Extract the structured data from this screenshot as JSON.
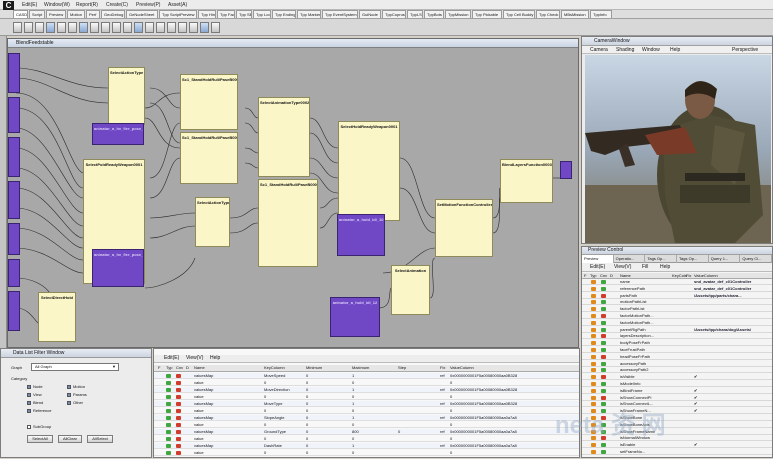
{
  "app": {
    "logo": "C"
  },
  "menubar": [
    "Edit(E)",
    "Window(W)",
    "Report(R)",
    "Create(C)",
    "Preview(P)",
    "Asset(A)"
  ],
  "tabs": [
    "CASDebug",
    "Script",
    "Preview",
    "Motion",
    "Perf",
    "GeoDebug",
    "GeNodeSheet",
    "Tpp ScriptPreview",
    "Tpp Hint",
    "Tpp Fade",
    "Tpp SE",
    "Tpp Loop",
    "Tpp Ending",
    "Tpp Marker",
    "Tpp EventSystem",
    "GuiNode",
    "TppCoprus",
    "TppLS",
    "TppBots",
    "TppMission",
    "Tpp Pickable",
    "Tpp Cell Buddy",
    "Tpp Check",
    "MBsMission",
    "TppInfo"
  ],
  "graph": {
    "title": "BlendFeedstable",
    "nodes": [
      {
        "label": "SelectActionType"
      },
      {
        "label": "Sc1_StandHoldRuli/PaseB0003"
      },
      {
        "label": "SelectAnimationType0002"
      },
      {
        "label": "Sc1_StandHoldRuli/PaseB0004"
      },
      {
        "label": "SelectHoldReadyWeapon0001"
      },
      {
        "label": "SelectPoldReadyWeapon0001"
      },
      {
        "label": "SelectActionType0000"
      },
      {
        "label": "Sc1_StandHoldRuli/PaseB0005"
      },
      {
        "label": "BlendLayersFunction0003"
      },
      {
        "label": "SetMotionFunctionController"
      },
      {
        "label": "SelectAnimation"
      },
      {
        "label": "SelectDirectHold"
      },
      {
        "label": "aninator_a_hv_fire_pose_01"
      },
      {
        "label": "aninator_a_hv_fire_pose_02"
      },
      {
        "label": "aninator_a_hold_idl_10"
      },
      {
        "label": "aninator_a_hold_idl_12"
      }
    ]
  },
  "camera": {
    "title": "CameraWindow",
    "menu": [
      "Camera",
      "Shading",
      "Window",
      "Help"
    ],
    "mode": "Perspective"
  },
  "preview": {
    "title": "Preview Control",
    "tabs": [
      "Preview",
      "Operatio...",
      "Tags Op...",
      "Tags Op...",
      "Query 1...",
      "Query Cl..."
    ],
    "menu": [
      "Edit(E)",
      "View(V)",
      "Fill",
      "Help"
    ],
    "header": [
      "F",
      "Typ",
      "Cnv",
      "D",
      "Name",
      "KeyCols",
      "Fix",
      "ValueColumn"
    ],
    "rows": [
      {
        "name": "name",
        "value": "snd_avatar_def_c01Controller"
      },
      {
        "name": "referencePath",
        "value": "snd_avatar_def_c01Controller"
      },
      {
        "name": "partsPath",
        "value": "/Assets/tpp/parts/chara..."
      },
      {
        "name": "motionPathList",
        "value": ""
      },
      {
        "name": "factorPathList",
        "value": ""
      },
      {
        "name": "factorMotionPath...",
        "value": ""
      },
      {
        "name": "factorMotionPath...",
        "value": ""
      },
      {
        "name": "parentRigPath",
        "value": "/Assets/tpp/chara/dog/Assets/"
      },
      {
        "name": "layersDescription...",
        "value": ""
      },
      {
        "name": "bodyPoseFrPath",
        "value": ""
      },
      {
        "name": "faceFrustPath",
        "value": ""
      },
      {
        "name": "headPoseFrPath",
        "value": ""
      },
      {
        "name": "accessoryPath",
        "value": ""
      },
      {
        "name": "accessoryPath2",
        "value": ""
      },
      {
        "name": "isVisible",
        "value": "✔"
      },
      {
        "name": "isModelInfo",
        "value": ""
      },
      {
        "name": "isBindFrame",
        "value": "✔"
      },
      {
        "name": "isShowConnectPl",
        "value": "✔"
      },
      {
        "name": "isShowConnectL...",
        "value": "✔"
      },
      {
        "name": "isShowFrameN...",
        "value": "✔"
      },
      {
        "name": "isShowBone",
        "value": ""
      },
      {
        "name": "isShowBoneAxis",
        "value": ""
      },
      {
        "name": "isShowFrameName",
        "value": ""
      },
      {
        "name": "isNormalWindow",
        "value": ""
      },
      {
        "name": "isEnable",
        "value": "✔"
      },
      {
        "name": "setFrameNo...",
        "value": ""
      }
    ]
  },
  "dlf": {
    "title": "Data List Filter Window",
    "graph_label": "Graph",
    "graph_value": "All Graph",
    "category_label": "Category",
    "categories": [
      {
        "label": "Node",
        "checked": true
      },
      {
        "label": "Motion",
        "checked": true
      },
      {
        "label": "View",
        "checked": true
      },
      {
        "label": "Params",
        "checked": true
      },
      {
        "label": "Blend",
        "checked": true
      },
      {
        "label": "Other",
        "checked": true
      },
      {
        "label": "Reference",
        "checked": true
      }
    ],
    "sub_label": "SubGroup",
    "buttons": [
      "SelectAll",
      "AllClear",
      "AllSelect"
    ]
  },
  "table": {
    "menu": [
      "Edit(E)",
      "View(V)",
      "Help"
    ],
    "header": [
      "F",
      "Typ",
      "Cnv",
      "D",
      "Name",
      "KeyColumn",
      "Minimum",
      "Maximum",
      "Step",
      "Fix",
      "ValueColumn"
    ],
    "rows": [
      {
        "name": "valuesMap",
        "key": "MoveSpeed",
        "min": "0",
        "max": "1",
        "step": "",
        "fix": "ref",
        "value": "0x0000000001F5a00080000aa0B328"
      },
      {
        "name": "value",
        "key": "0",
        "min": "0",
        "max": "0",
        "step": "",
        "fix": "",
        "value": "0"
      },
      {
        "name": "valuesMap",
        "key": "MoveDirection",
        "min": "0",
        "max": "1",
        "step": "",
        "fix": "ref",
        "value": "0x0000000001F5a00080000aa0B328"
      },
      {
        "name": "value",
        "key": "0",
        "min": "0",
        "max": "0",
        "step": "",
        "fix": "",
        "value": "0"
      },
      {
        "name": "valuesMap",
        "key": "MoveType",
        "min": "0",
        "max": "1",
        "step": "",
        "fix": "ref",
        "value": "0x0000000001F5a00080000aa0B328"
      },
      {
        "name": "value",
        "key": "0",
        "min": "0",
        "max": "0",
        "step": "",
        "fix": "",
        "value": "0"
      },
      {
        "name": "valuesMap",
        "key": "SlopeAngle",
        "min": "0",
        "max": "1",
        "step": "",
        "fix": "ref",
        "value": "0x0000000001F5a00080000aa0a7a8"
      },
      {
        "name": "value",
        "key": "0",
        "min": "0",
        "max": "0",
        "step": "",
        "fix": "",
        "value": "0"
      },
      {
        "name": "valuesMap",
        "key": "GroundType",
        "min": "0",
        "max": "800",
        "step": "0",
        "fix": "ref",
        "value": "0x0000000001F5a00080000aa0a7a8"
      },
      {
        "name": "value",
        "key": "0",
        "min": "0",
        "max": "0",
        "step": "",
        "fix": "",
        "value": "0"
      },
      {
        "name": "valuesMap",
        "key": "DashRate",
        "min": "0",
        "max": "1",
        "step": "",
        "fix": "ref",
        "value": "0x0000000001F5a00080000aa0a7a8"
      },
      {
        "name": "value",
        "key": "0",
        "min": "0",
        "max": "0",
        "step": "",
        "fix": "",
        "value": "0"
      }
    ]
  },
  "colors": {
    "node_yellow": "#fbf6c8",
    "node_purple": "#7048c6",
    "graph_bg": "#a8a8a8",
    "badge_green": "#3fa640",
    "badge_red": "#d23c2c",
    "badge_orange": "#e08a1a"
  },
  "watermark": "neta 资 网"
}
